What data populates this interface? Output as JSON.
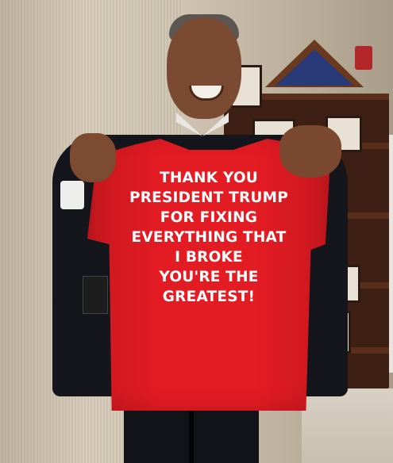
{
  "photo": {
    "shirt_lines": [
      "THANK YOU",
      "PRESIDENT TRUMP",
      "FOR FIXING",
      "EVERYTHING THAT",
      "I BROKE",
      "YOU'RE THE",
      "GREATEST!"
    ],
    "colors": {
      "shirt": "#e31b23",
      "shirt_text": "#ffffff",
      "jacket": "#14161c",
      "shelf": "#3d1f14"
    }
  }
}
